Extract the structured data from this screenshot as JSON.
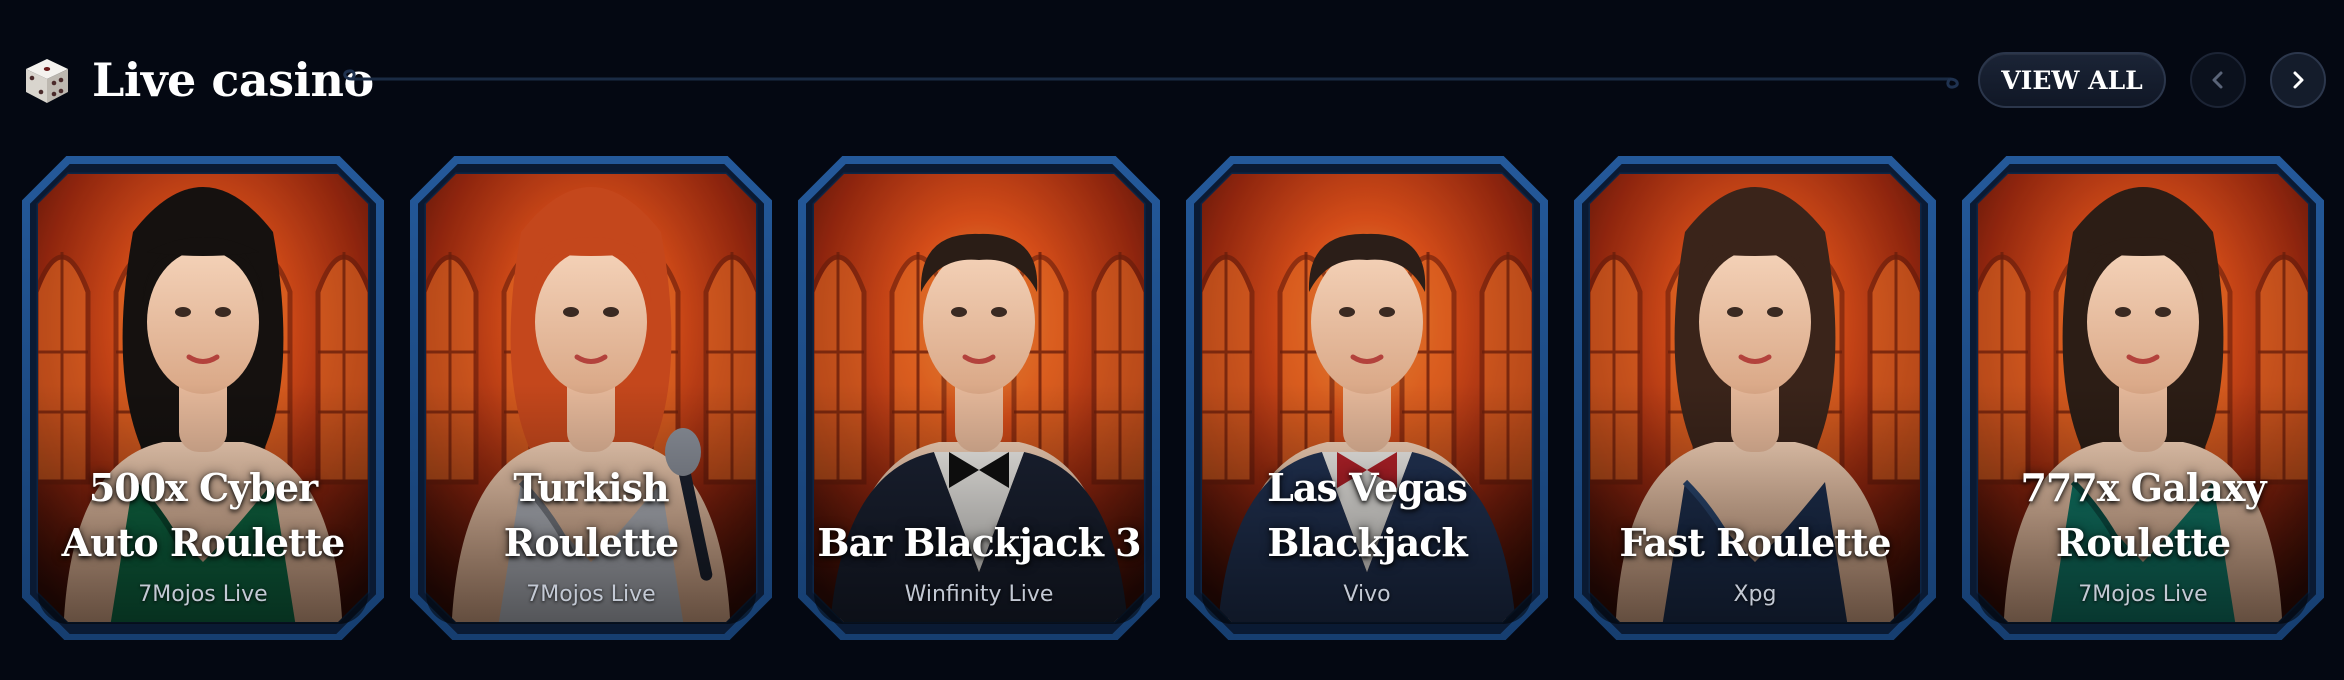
{
  "section": {
    "title": "Live casino",
    "icon": "dice-icon",
    "view_all_label": "VIEW ALL",
    "prev_icon": "chevron-left-icon",
    "next_icon": "chevron-right-icon"
  },
  "colors": {
    "background": "#040812",
    "card_border": "#1d4a80",
    "card_border_inner": "#0a1a33",
    "backdrop_warm": "#e2431a",
    "provider_text": "#c3c9d4"
  },
  "games": [
    {
      "title_lines": [
        "500x Cyber",
        "Auto Roulette"
      ],
      "provider": "7Mojos Live",
      "host": "woman-green-dress"
    },
    {
      "title_lines": [
        "",
        "Turkish Roulette"
      ],
      "provider": "7Mojos Live",
      "host": "woman-silver-dress-microphone"
    },
    {
      "title_lines": [
        "",
        "Bar Blackjack 3"
      ],
      "provider": "Winfinity Live",
      "host": "man-black-vest-bowtie"
    },
    {
      "title_lines": [
        "Las Vegas",
        "Blackjack"
      ],
      "provider": "Vivo",
      "host": "man-navy-suit-red-bowtie"
    },
    {
      "title_lines": [
        "",
        "Fast Roulette"
      ],
      "provider": "Xpg",
      "host": "woman-navy-dress"
    },
    {
      "title_lines": [
        "777x Galaxy",
        "Roulette"
      ],
      "provider": "7Mojos Live",
      "host": "woman-teal-dress"
    }
  ]
}
